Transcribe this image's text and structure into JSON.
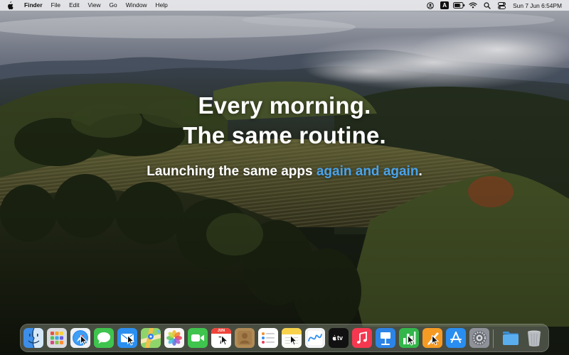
{
  "menubar": {
    "app_name": "Finder",
    "menus": [
      "File",
      "Edit",
      "View",
      "Go",
      "Window",
      "Help"
    ],
    "input_source": "A",
    "clock": "Sun 7 Jun  6:54PM",
    "status_icons": [
      "account-icon",
      "input-source-icon",
      "battery-icon",
      "wifi-icon",
      "spotlight-icon",
      "control-center-icon"
    ]
  },
  "hero": {
    "line1": "Every morning.",
    "line2": "The same routine.",
    "sub_plain": "Launching the same apps ",
    "sub_accent": "again and again",
    "sub_end": "."
  },
  "dock": {
    "apps": [
      "finder",
      "launchpad",
      "safari",
      "messages",
      "mail",
      "maps",
      "photos",
      "facetime",
      "calendar",
      "contacts",
      "reminders",
      "notes",
      "freeform",
      "apple-tv",
      "music",
      "keynote",
      "numbers",
      "pages",
      "app-store",
      "system-settings",
      "downloads-folder",
      "trash"
    ],
    "calendar_month": "JUN",
    "calendar_day": "7",
    "tv_label": "tv",
    "cursor_on": [
      "safari",
      "mail",
      "calendar",
      "notes",
      "numbers",
      "pages"
    ]
  },
  "colors": {
    "accent_text": "#4aa3ea",
    "menubar_bg": "#ebebee"
  }
}
